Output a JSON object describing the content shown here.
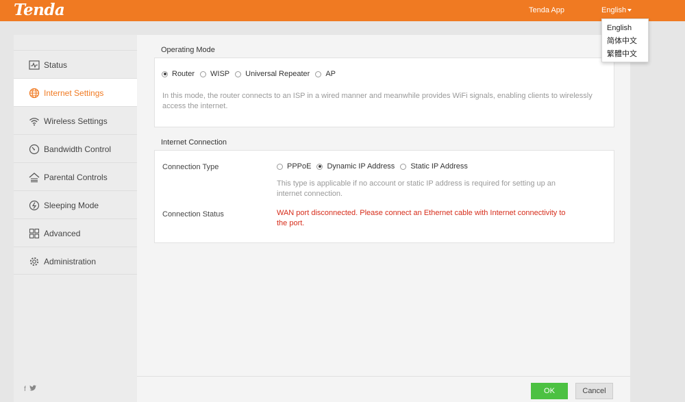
{
  "header": {
    "logo": "Tenda",
    "app_link": "Tenda App",
    "language_current": "English"
  },
  "language_menu": {
    "items": [
      "English",
      "简体中文",
      "繁體中文"
    ]
  },
  "sidebar": {
    "items": [
      {
        "label": "Status",
        "icon": "status-icon"
      },
      {
        "label": "Internet Settings",
        "icon": "globe-icon",
        "active": true
      },
      {
        "label": "Wireless Settings",
        "icon": "wifi-icon"
      },
      {
        "label": "Bandwidth Control",
        "icon": "gauge-icon"
      },
      {
        "label": "Parental Controls",
        "icon": "house-icon"
      },
      {
        "label": "Sleeping Mode",
        "icon": "sleep-icon"
      },
      {
        "label": "Advanced",
        "icon": "grid-icon"
      },
      {
        "label": "Administration",
        "icon": "gear-icon"
      }
    ],
    "social": [
      "f",
      "t"
    ]
  },
  "operating_mode": {
    "title": "Operating Mode",
    "options": [
      "Router",
      "WISP",
      "Universal Repeater",
      "AP"
    ],
    "selected": "Router",
    "description": "In this mode, the router connects to an ISP in a wired manner and meanwhile provides WiFi signals, enabling clients to wirelessly access the internet."
  },
  "internet_connection": {
    "title": "Internet Connection",
    "connection_type_label": "Connection Type",
    "options": [
      "PPPoE",
      "Dynamic IP Address",
      "Static IP Address"
    ],
    "selected": "Dynamic IP Address",
    "type_description": "This type is applicable if no account or static IP address is required for setting up an internet connection.",
    "connection_status_label": "Connection Status",
    "connection_status_value": "WAN port disconnected. Please connect an Ethernet cable with Internet connectivity to the port."
  },
  "footer": {
    "ok_label": "OK",
    "cancel_label": "Cancel"
  },
  "colors": {
    "brand": "#f07a22",
    "ok_button": "#4cc142",
    "error_text": "#d62c1a"
  }
}
